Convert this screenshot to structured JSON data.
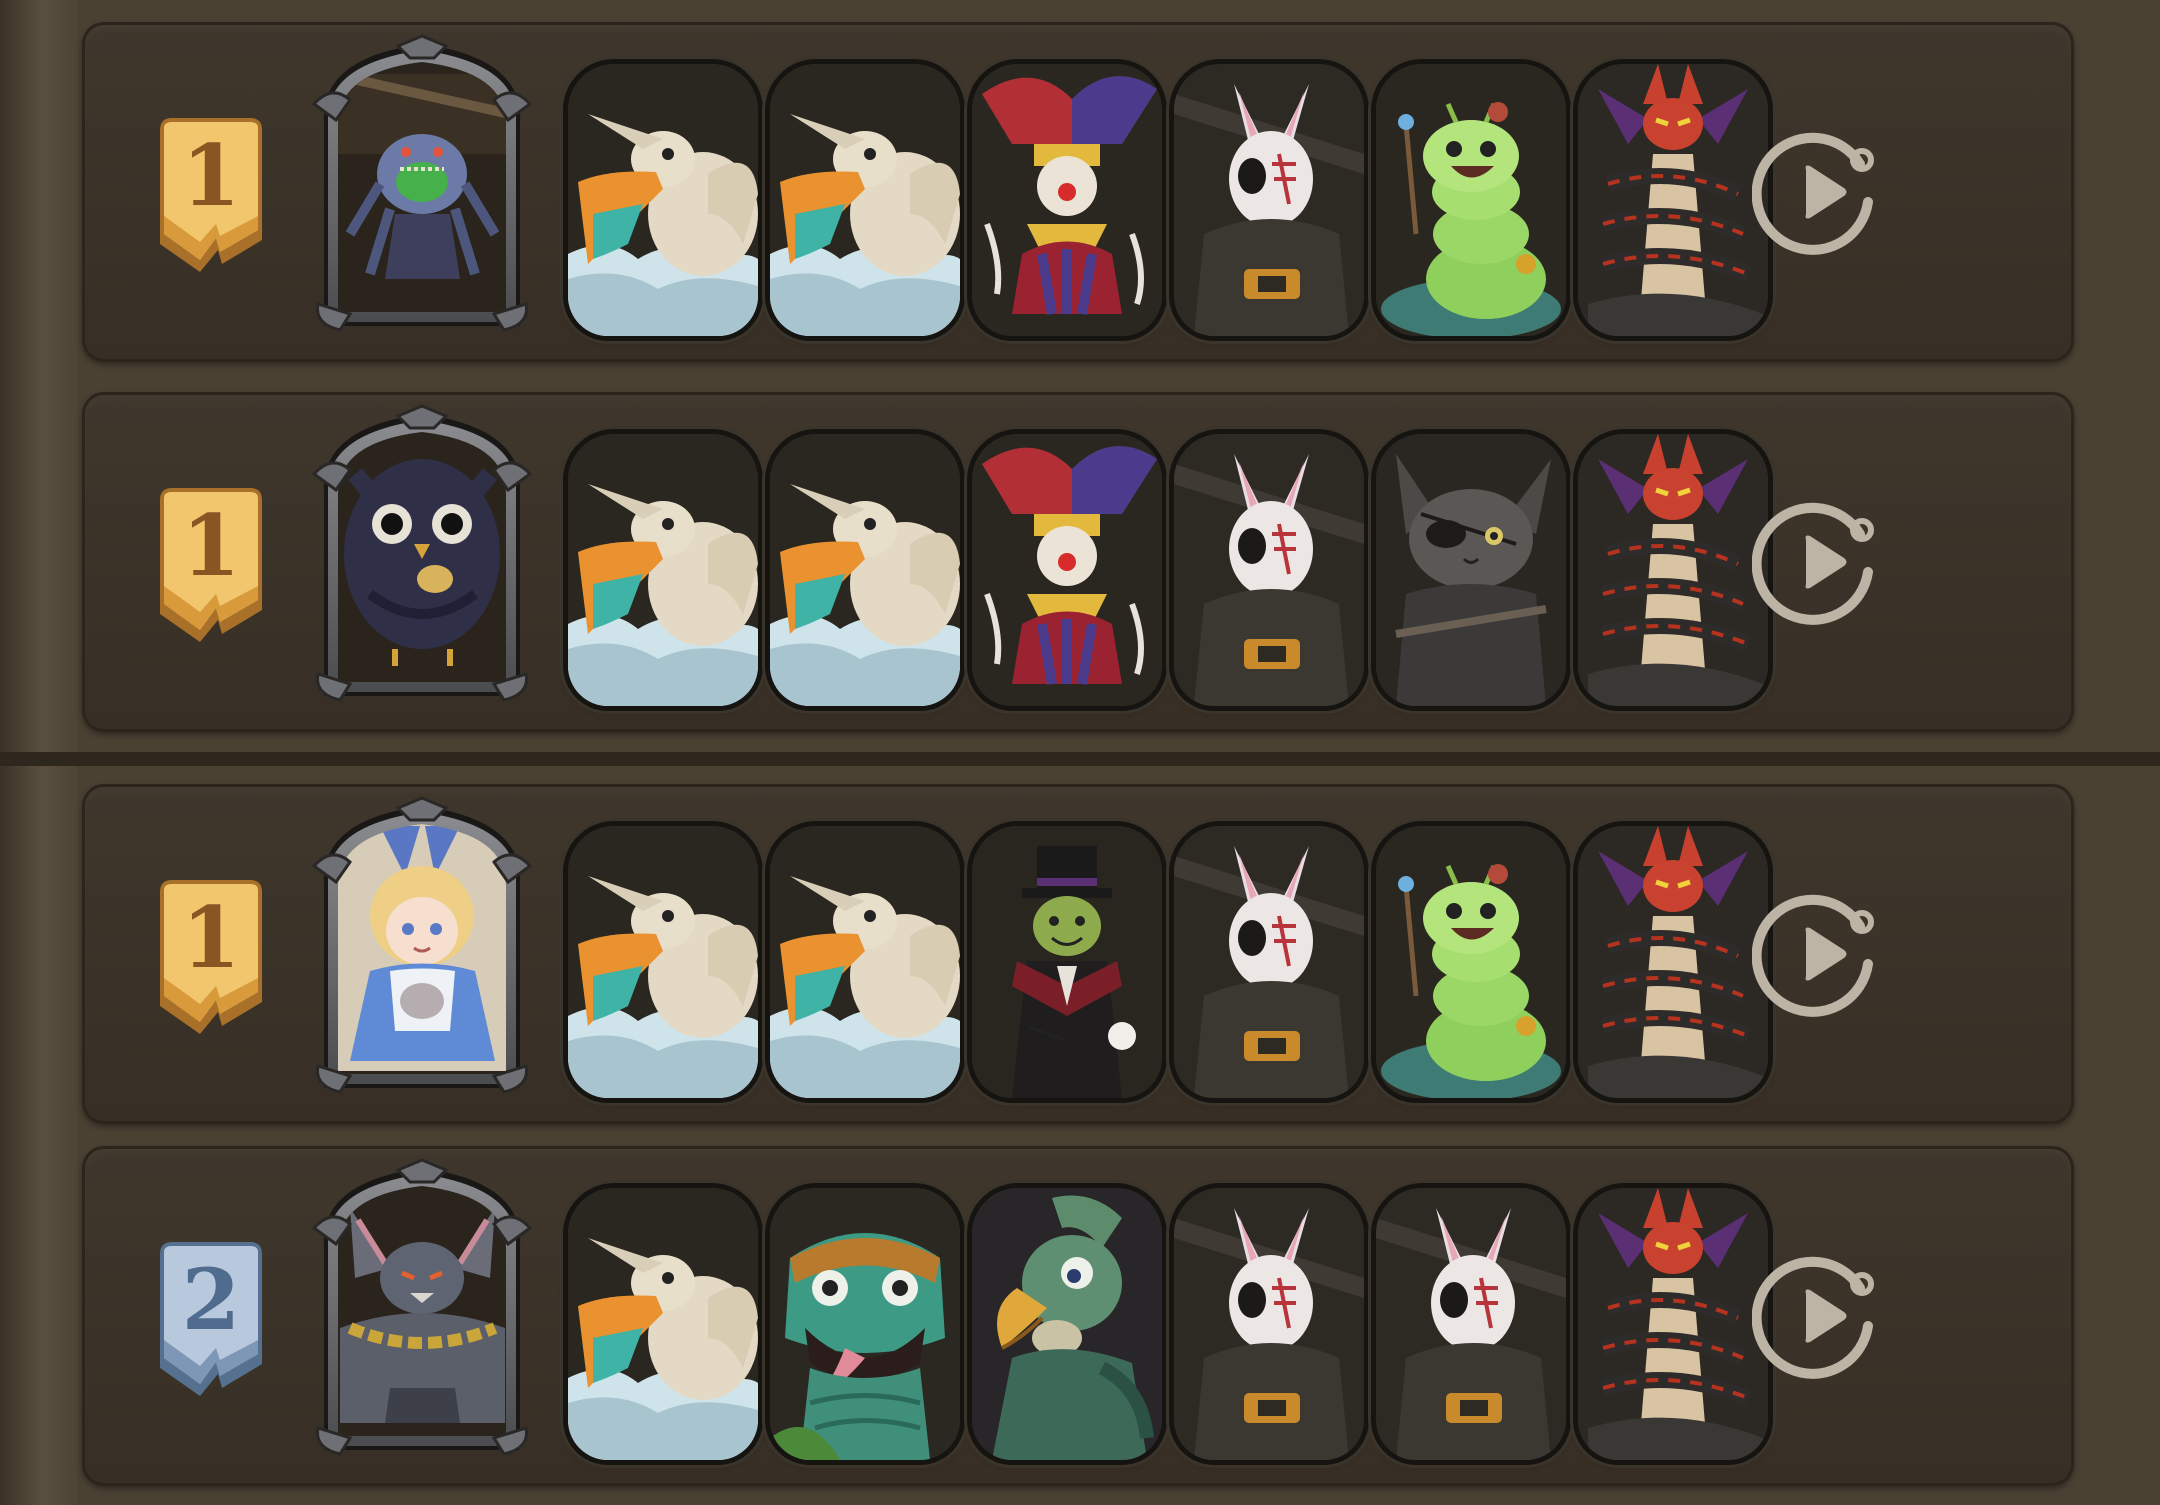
{
  "colors": {
    "rank_gold": "#e9b95e",
    "rank_silver": "#a9bcd4",
    "panel": "#3c342a",
    "replay_icon": "#bdb4a5"
  },
  "rows": [
    {
      "rank": "1",
      "rank_tier": "gold",
      "leader_icon": "green-mouthed-spider-creature-icon",
      "cards": [
        "pelican-icon",
        "pelican-icon",
        "jester-clown-icon",
        "scarred-rabbit-icon",
        "caterpillar-icon",
        "coiled-serpent-demon-icon"
      ]
    },
    {
      "rank": "1",
      "rank_tier": "gold",
      "leader_icon": "owl-icon",
      "cards": [
        "pelican-icon",
        "pelican-icon",
        "jester-clown-icon",
        "scarred-rabbit-icon",
        "eyepatch-cat-icon",
        "coiled-serpent-demon-icon"
      ]
    },
    {
      "rank": "1",
      "rank_tier": "gold",
      "leader_icon": "alice-girl-icon",
      "cards": [
        "pelican-icon",
        "pelican-icon",
        "top-hat-cricket-icon",
        "scarred-rabbit-icon",
        "caterpillar-icon",
        "coiled-serpent-demon-icon"
      ]
    },
    {
      "rank": "2",
      "rank_tier": "silver",
      "leader_icon": "chained-bat-brute-icon",
      "cards": [
        "pelican-icon",
        "green-lizard-icon",
        "parrot-icon",
        "scarred-rabbit-icon",
        "scarred-rabbit-icon",
        "coiled-serpent-demon-icon"
      ]
    }
  ]
}
